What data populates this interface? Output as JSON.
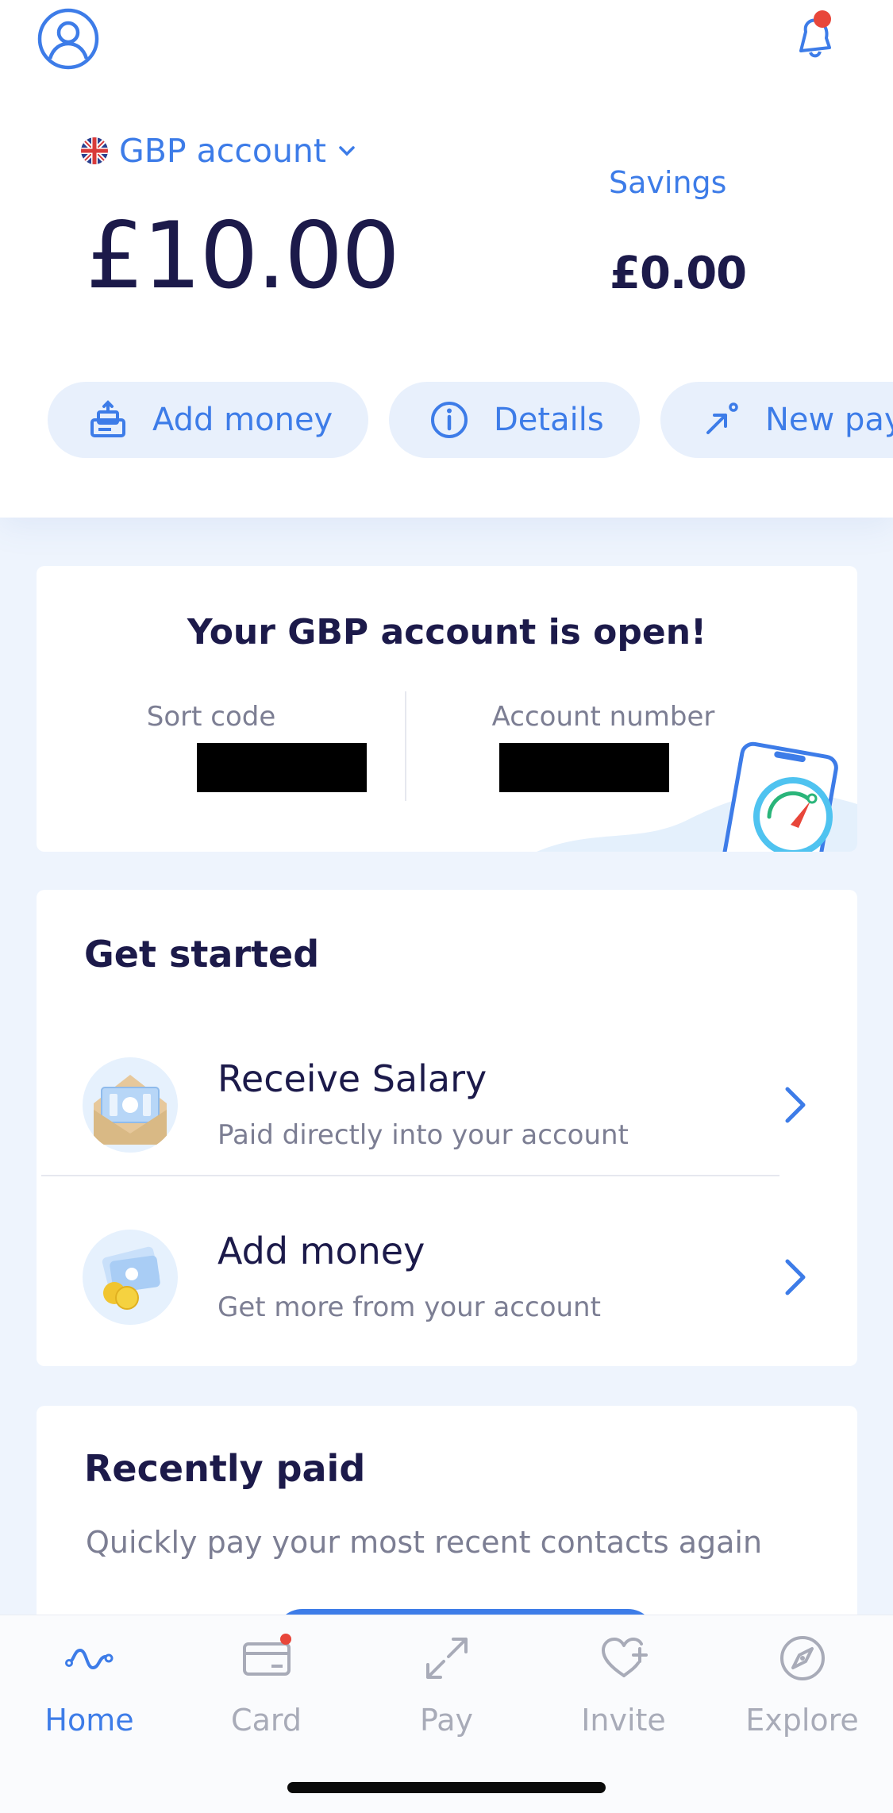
{
  "header": {
    "account_selector": "GBP account",
    "balance": "£10.00",
    "savings_label": "Savings",
    "savings_value": "£0.00",
    "actions": [
      {
        "label": "Add money",
        "icon": "add-money-icon"
      },
      {
        "label": "Details",
        "icon": "info-icon"
      },
      {
        "label": "New pay",
        "icon": "new-payment-icon"
      }
    ]
  },
  "account_open": {
    "title": "Your GBP account is open!",
    "sort_code_label": "Sort code",
    "account_number_label": "Account number"
  },
  "get_started": {
    "title": "Get started",
    "items": [
      {
        "title": "Receive Salary",
        "subtitle": "Paid directly into your account"
      },
      {
        "title": "Add money",
        "subtitle": "Get more from your account"
      }
    ]
  },
  "recently_paid": {
    "title": "Recently paid",
    "subtitle": "Quickly pay your most recent contacts again"
  },
  "tabbar": {
    "items": [
      {
        "label": "Home",
        "icon": "home-wave-icon",
        "active": true
      },
      {
        "label": "Card",
        "icon": "card-icon",
        "active": false,
        "badge": true
      },
      {
        "label": "Pay",
        "icon": "pay-arrows-icon",
        "active": false
      },
      {
        "label": "Invite",
        "icon": "heart-plus-icon",
        "active": false
      },
      {
        "label": "Explore",
        "icon": "compass-icon",
        "active": false
      }
    ]
  },
  "colors": {
    "accent": "#3d7ce8",
    "text_dark": "#1c1a4a",
    "text_muted": "#7c7e93",
    "background": "#eef4fd",
    "notification_dot": "#e8463a"
  }
}
